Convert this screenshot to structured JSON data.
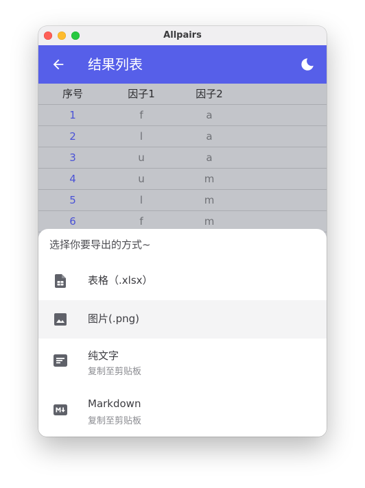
{
  "window": {
    "title": "Allpairs"
  },
  "appbar": {
    "title": "结果列表",
    "back_icon": "arrow-back-icon",
    "theme_icon": "moon-icon",
    "color": "#565fe9"
  },
  "table": {
    "headers": [
      "序号",
      "因子1",
      "因子2"
    ],
    "rows": [
      [
        "1",
        "f",
        "a"
      ],
      [
        "2",
        "l",
        "a"
      ],
      [
        "3",
        "u",
        "a"
      ],
      [
        "4",
        "u",
        "m"
      ],
      [
        "5",
        "l",
        "m"
      ],
      [
        "6",
        "f",
        "m"
      ]
    ]
  },
  "sheet": {
    "title": "选择你要导出的方式~",
    "options": [
      {
        "label": "表格（.xlsx）",
        "icon": "spreadsheet-file-icon"
      },
      {
        "label": "图片(.png)",
        "icon": "image-icon"
      },
      {
        "label": "纯文字",
        "sub": "复制至剪贴板",
        "icon": "text-notes-icon"
      },
      {
        "label": "Markdown",
        "sub": "复制至剪贴板",
        "icon": "markdown-icon"
      }
    ]
  }
}
